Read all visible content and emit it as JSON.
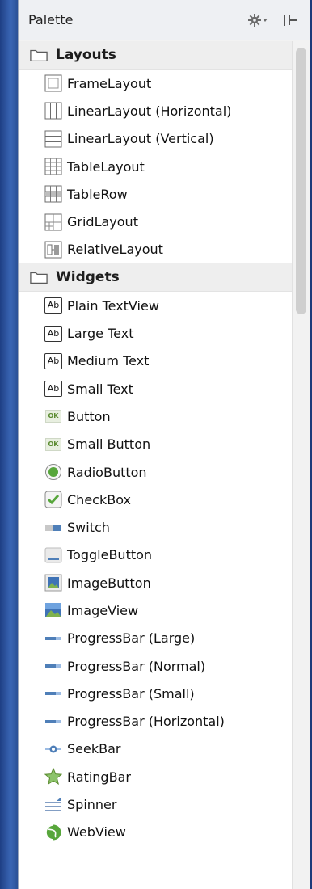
{
  "panel": {
    "title": "Palette",
    "settings_icon": "gear-dropdown-icon",
    "pin_icon": "pin-icon"
  },
  "categories": [
    {
      "label": "Layouts",
      "items": [
        {
          "label": "FrameLayout",
          "icon": "frame-layout-icon"
        },
        {
          "label": "LinearLayout (Horizontal)",
          "icon": "linear-horizontal-icon"
        },
        {
          "label": "LinearLayout (Vertical)",
          "icon": "linear-vertical-icon"
        },
        {
          "label": "TableLayout",
          "icon": "table-layout-icon"
        },
        {
          "label": "TableRow",
          "icon": "table-row-icon"
        },
        {
          "label": "GridLayout",
          "icon": "grid-layout-icon"
        },
        {
          "label": "RelativeLayout",
          "icon": "relative-layout-icon"
        }
      ]
    },
    {
      "label": "Widgets",
      "items": [
        {
          "label": "Plain TextView",
          "icon": "text-ab-icon"
        },
        {
          "label": "Large Text",
          "icon": "text-ab-icon"
        },
        {
          "label": "Medium Text",
          "icon": "text-ab-icon"
        },
        {
          "label": "Small Text",
          "icon": "text-ab-icon"
        },
        {
          "label": "Button",
          "icon": "ok-button-icon"
        },
        {
          "label": "Small Button",
          "icon": "ok-button-icon"
        },
        {
          "label": "RadioButton",
          "icon": "radio-icon"
        },
        {
          "label": "CheckBox",
          "icon": "checkbox-icon"
        },
        {
          "label": "Switch",
          "icon": "switch-icon"
        },
        {
          "label": "ToggleButton",
          "icon": "toggle-icon"
        },
        {
          "label": "ImageButton",
          "icon": "image-button-icon"
        },
        {
          "label": "ImageView",
          "icon": "image-view-icon"
        },
        {
          "label": "ProgressBar (Large)",
          "icon": "progressbar-icon"
        },
        {
          "label": "ProgressBar (Normal)",
          "icon": "progressbar-icon"
        },
        {
          "label": "ProgressBar (Small)",
          "icon": "progressbar-icon"
        },
        {
          "label": "ProgressBar (Horizontal)",
          "icon": "progressbar-icon"
        },
        {
          "label": "SeekBar",
          "icon": "seekbar-icon"
        },
        {
          "label": "RatingBar",
          "icon": "star-icon"
        },
        {
          "label": "Spinner",
          "icon": "spinner-icon"
        },
        {
          "label": "WebView",
          "icon": "globe-icon"
        }
      ]
    }
  ],
  "colors": {
    "panel_bg": "#f2f2f2",
    "desktop_bg": "#2b4c8a",
    "category_bg": "#eeeeee",
    "accent_green": "#57a63b",
    "progress_blue": "#4f7fb8"
  }
}
